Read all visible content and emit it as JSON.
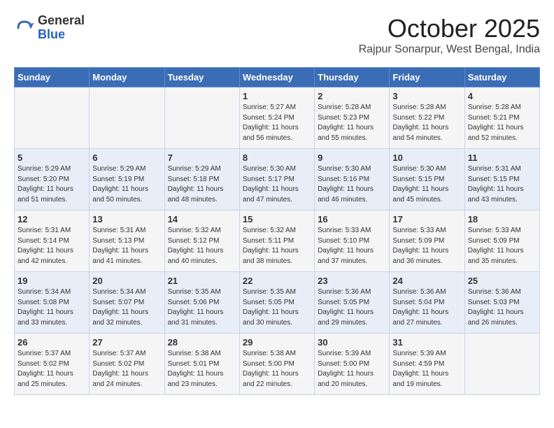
{
  "header": {
    "logo_general": "General",
    "logo_blue": "Blue",
    "month_title": "October 2025",
    "subtitle": "Rajpur Sonarpur, West Bengal, India"
  },
  "days_of_week": [
    "Sunday",
    "Monday",
    "Tuesday",
    "Wednesday",
    "Thursday",
    "Friday",
    "Saturday"
  ],
  "weeks": [
    [
      {
        "day": "",
        "info": ""
      },
      {
        "day": "",
        "info": ""
      },
      {
        "day": "",
        "info": ""
      },
      {
        "day": "1",
        "info": "Sunrise: 5:27 AM\nSunset: 5:24 PM\nDaylight: 11 hours and 56 minutes."
      },
      {
        "day": "2",
        "info": "Sunrise: 5:28 AM\nSunset: 5:23 PM\nDaylight: 11 hours and 55 minutes."
      },
      {
        "day": "3",
        "info": "Sunrise: 5:28 AM\nSunset: 5:22 PM\nDaylight: 11 hours and 54 minutes."
      },
      {
        "day": "4",
        "info": "Sunrise: 5:28 AM\nSunset: 5:21 PM\nDaylight: 11 hours and 52 minutes."
      }
    ],
    [
      {
        "day": "5",
        "info": "Sunrise: 5:29 AM\nSunset: 5:20 PM\nDaylight: 11 hours and 51 minutes."
      },
      {
        "day": "6",
        "info": "Sunrise: 5:29 AM\nSunset: 5:19 PM\nDaylight: 11 hours and 50 minutes."
      },
      {
        "day": "7",
        "info": "Sunrise: 5:29 AM\nSunset: 5:18 PM\nDaylight: 11 hours and 48 minutes."
      },
      {
        "day": "8",
        "info": "Sunrise: 5:30 AM\nSunset: 5:17 PM\nDaylight: 11 hours and 47 minutes."
      },
      {
        "day": "9",
        "info": "Sunrise: 5:30 AM\nSunset: 5:16 PM\nDaylight: 11 hours and 46 minutes."
      },
      {
        "day": "10",
        "info": "Sunrise: 5:30 AM\nSunset: 5:15 PM\nDaylight: 11 hours and 45 minutes."
      },
      {
        "day": "11",
        "info": "Sunrise: 5:31 AM\nSunset: 5:15 PM\nDaylight: 11 hours and 43 minutes."
      }
    ],
    [
      {
        "day": "12",
        "info": "Sunrise: 5:31 AM\nSunset: 5:14 PM\nDaylight: 11 hours and 42 minutes."
      },
      {
        "day": "13",
        "info": "Sunrise: 5:31 AM\nSunset: 5:13 PM\nDaylight: 11 hours and 41 minutes."
      },
      {
        "day": "14",
        "info": "Sunrise: 5:32 AM\nSunset: 5:12 PM\nDaylight: 11 hours and 40 minutes."
      },
      {
        "day": "15",
        "info": "Sunrise: 5:32 AM\nSunset: 5:11 PM\nDaylight: 11 hours and 38 minutes."
      },
      {
        "day": "16",
        "info": "Sunrise: 5:33 AM\nSunset: 5:10 PM\nDaylight: 11 hours and 37 minutes."
      },
      {
        "day": "17",
        "info": "Sunrise: 5:33 AM\nSunset: 5:09 PM\nDaylight: 11 hours and 36 minutes."
      },
      {
        "day": "18",
        "info": "Sunrise: 5:33 AM\nSunset: 5:09 PM\nDaylight: 11 hours and 35 minutes."
      }
    ],
    [
      {
        "day": "19",
        "info": "Sunrise: 5:34 AM\nSunset: 5:08 PM\nDaylight: 11 hours and 33 minutes."
      },
      {
        "day": "20",
        "info": "Sunrise: 5:34 AM\nSunset: 5:07 PM\nDaylight: 11 hours and 32 minutes."
      },
      {
        "day": "21",
        "info": "Sunrise: 5:35 AM\nSunset: 5:06 PM\nDaylight: 11 hours and 31 minutes."
      },
      {
        "day": "22",
        "info": "Sunrise: 5:35 AM\nSunset: 5:05 PM\nDaylight: 11 hours and 30 minutes."
      },
      {
        "day": "23",
        "info": "Sunrise: 5:36 AM\nSunset: 5:05 PM\nDaylight: 11 hours and 29 minutes."
      },
      {
        "day": "24",
        "info": "Sunrise: 5:36 AM\nSunset: 5:04 PM\nDaylight: 11 hours and 27 minutes."
      },
      {
        "day": "25",
        "info": "Sunrise: 5:36 AM\nSunset: 5:03 PM\nDaylight: 11 hours and 26 minutes."
      }
    ],
    [
      {
        "day": "26",
        "info": "Sunrise: 5:37 AM\nSunset: 5:02 PM\nDaylight: 11 hours and 25 minutes."
      },
      {
        "day": "27",
        "info": "Sunrise: 5:37 AM\nSunset: 5:02 PM\nDaylight: 11 hours and 24 minutes."
      },
      {
        "day": "28",
        "info": "Sunrise: 5:38 AM\nSunset: 5:01 PM\nDaylight: 11 hours and 23 minutes."
      },
      {
        "day": "29",
        "info": "Sunrise: 5:38 AM\nSunset: 5:00 PM\nDaylight: 11 hours and 22 minutes."
      },
      {
        "day": "30",
        "info": "Sunrise: 5:39 AM\nSunset: 5:00 PM\nDaylight: 11 hours and 20 minutes."
      },
      {
        "day": "31",
        "info": "Sunrise: 5:39 AM\nSunset: 4:59 PM\nDaylight: 11 hours and 19 minutes."
      },
      {
        "day": "",
        "info": ""
      }
    ]
  ]
}
